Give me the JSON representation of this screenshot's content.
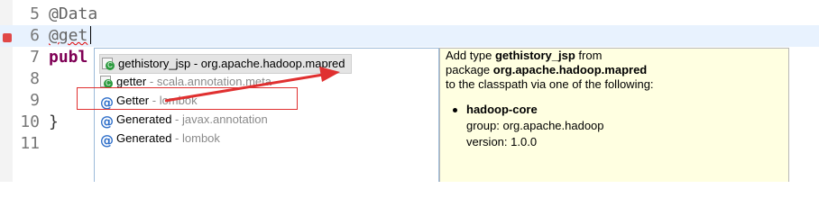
{
  "editor": {
    "lines": [
      {
        "number": "5",
        "text": "@Data"
      },
      {
        "number": "6",
        "text": "@get"
      },
      {
        "number": "7",
        "text": "publ"
      },
      {
        "number": "8",
        "text": ""
      },
      {
        "number": "9",
        "text": ""
      },
      {
        "number": "10",
        "text": "}"
      },
      {
        "number": "11",
        "text": ""
      }
    ]
  },
  "completion": {
    "items": [
      {
        "name": "gethistory_jsp",
        "separator": " - ",
        "qualifier": "org.apache.hadoop.mapred",
        "icon": "class-import-icon"
      },
      {
        "name": "getter",
        "separator": " - ",
        "qualifier": "scala.annotation.meta",
        "icon": "class-import-icon"
      },
      {
        "name": "Getter",
        "separator": " - ",
        "qualifier": "lombok",
        "icon": "annotation-icon"
      },
      {
        "name": "Generated",
        "separator": " - ",
        "qualifier": "javax.annotation",
        "icon": "annotation-icon"
      },
      {
        "name": "Generated",
        "separator": " - ",
        "qualifier": "lombok",
        "icon": "annotation-icon"
      }
    ]
  },
  "doc": {
    "line1_prefix": "Add type ",
    "line1_type": "gethistory_jsp",
    "line1_suffix": " from",
    "line2_prefix": "package ",
    "line2_package": "org.apache.hadoop.mapred",
    "line3": "to the classpath via one of the following:",
    "artifact": "hadoop-core",
    "group": "group: org.apache.hadoop",
    "version": "version: 1.0.0"
  },
  "colors": {
    "highlight_box": "#e03030",
    "arrow": "#e03030",
    "doc_background": "#ffffe1",
    "current_line": "#e8f2fe"
  }
}
